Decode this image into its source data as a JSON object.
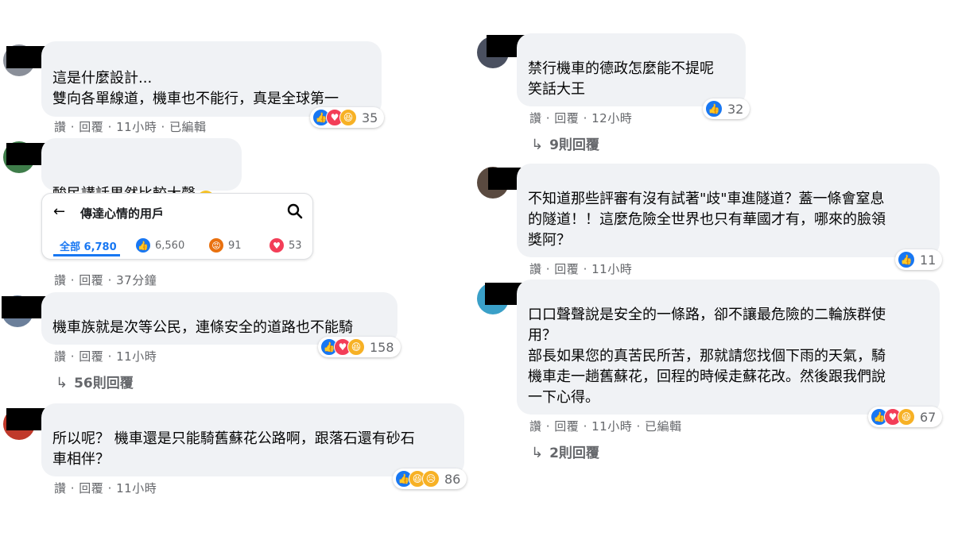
{
  "left_column": [
    {
      "text": "這是什麼設計...\n雙向各單線道，機車也不能行，真是全球第一",
      "reactions": {
        "icons": [
          "like-icon",
          "love-icon",
          "haha-icon"
        ],
        "count": "35"
      },
      "meta": "讚 · 回覆 · 11小時 · 已編輯"
    },
    {
      "text": "酸民講話果然比較大聲",
      "meta": "讚 · 回覆 · 37分鐘",
      "card": {
        "back": "←",
        "title": "傳達心情的用戶",
        "tabs": [
          {
            "label": "全部 6,780"
          },
          {
            "count": "6,560",
            "icon": "like-icon"
          },
          {
            "count": "91",
            "icon": "angry-icon"
          },
          {
            "count": "53",
            "icon": "love-icon"
          }
        ]
      }
    },
    {
      "text": "機車族就是次等公民，連條安全的道路也不能騎",
      "reactions": {
        "icons": [
          "like-icon",
          "love-icon",
          "haha-icon"
        ],
        "count": "158"
      },
      "meta": "讚 · 回覆 · 11小時",
      "replies": "56則回覆"
    },
    {
      "text": "所以呢？ 機車還是只能騎舊蘇花公路啊，跟落石還有砂石\n車相伴？",
      "reactions": {
        "icons": [
          "like-icon",
          "haha-icon",
          "sad-icon"
        ],
        "count": "86"
      },
      "meta": "讚 · 回覆 · 11小時"
    }
  ],
  "right_column": [
    {
      "text": "禁行機車的德政怎麼能不提呢\n笑話大王",
      "reactions": {
        "icons": [
          "like-icon"
        ],
        "count": "32"
      },
      "meta": "讚 · 回覆 · 12小時",
      "replies": "9則回覆"
    },
    {
      "text": "不知道那些評審有沒有試著\"歧\"車進隧道？蓋一條會窒息\n的隧道！！這麼危險全世界也只有華國才有，哪來的臉領\n獎阿？",
      "reactions": {
        "icons": [
          "like-icon"
        ],
        "count": "11"
      },
      "meta": "讚 · 回覆 · 11小時"
    },
    {
      "text": "口口聲聲說是安全的一條路，卻不讓最危險的二輪族群使\n用？\n部長如果您的真苦民所苦，那就請您找個下雨的天氣，騎\n機車走一趟舊蘇花，回程的時候走蘇花改。然後跟我們說\n一下心得。",
      "reactions": {
        "icons": [
          "like-icon",
          "love-icon",
          "haha-icon"
        ],
        "count": "67"
      },
      "meta": "讚 · 回覆 · 11小時 · 已編輯",
      "replies": "2則回覆"
    }
  ],
  "colors": {
    "bubble": "#f0f2f5",
    "meta": "#65676b",
    "like": "#1877f2",
    "love": "#f33e58",
    "haha": "#f7b125",
    "angry": "#e9710f"
  }
}
